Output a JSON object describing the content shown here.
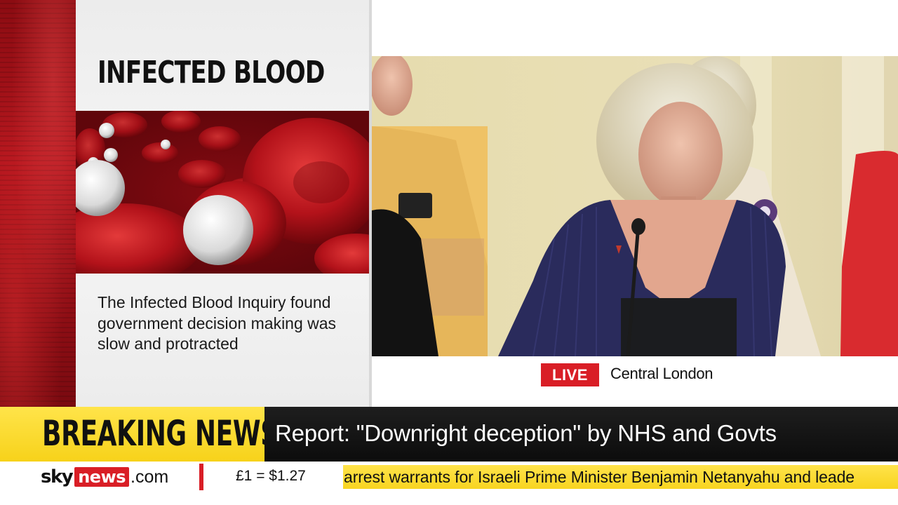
{
  "graphic": {
    "title": "INFECTED BLOOD",
    "body": "The Infected Blood Inquiry found government decision making was slow and protracted"
  },
  "video": {
    "live_label": "LIVE",
    "location": "Central London"
  },
  "breaking": {
    "label": "BREAKING NEWS",
    "headline": "Report: \"Downright deception\" by NHS and Govts"
  },
  "ticker": {
    "logo_sky": "sky",
    "logo_news": "news",
    "logo_com": ".com",
    "currency": "£1 = $1.27",
    "scrolling_text": "arrest warrants for Israeli Prime Minister Benjamin Netanyahu and leade"
  },
  "colors": {
    "sky_red": "#d91e26",
    "breaking_yellow": "#f7d21a",
    "headline_black": "#111111"
  }
}
